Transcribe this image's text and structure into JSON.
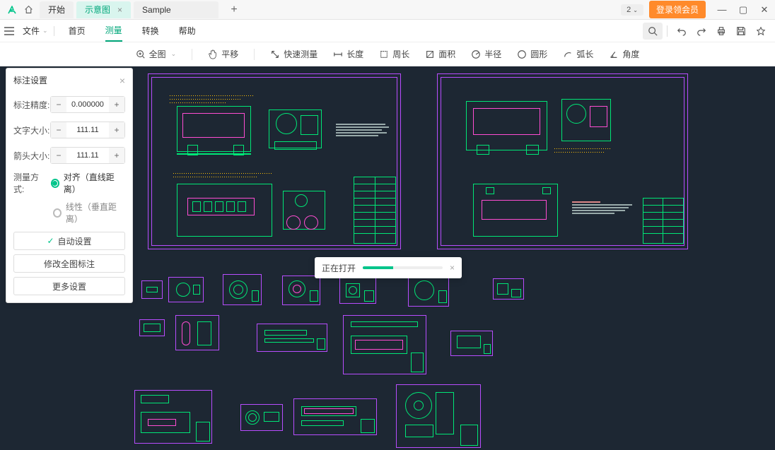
{
  "titlebar": {
    "tabs": [
      {
        "label": "开始",
        "active": false,
        "closable": false
      },
      {
        "label": "示意图",
        "active": true,
        "closable": true
      },
      {
        "label": "Sample",
        "active": false,
        "closable": false
      }
    ],
    "version_badge": "2",
    "login_btn": "登录领会员"
  },
  "menubar": {
    "file_label": "文件",
    "items": [
      {
        "label": "首页",
        "active": false
      },
      {
        "label": "测量",
        "active": true
      },
      {
        "label": "转换",
        "active": false
      },
      {
        "label": "帮助",
        "active": false
      }
    ]
  },
  "toolbar": {
    "items": [
      {
        "icon": "zoom-extents-icon",
        "label": "全图",
        "dropdown": true
      },
      {
        "icon": "pan-icon",
        "label": "平移"
      },
      {
        "icon": "quick-measure-icon",
        "label": "快速测量"
      },
      {
        "icon": "length-icon",
        "label": "长度"
      },
      {
        "icon": "perimeter-icon",
        "label": "周长"
      },
      {
        "icon": "area-icon",
        "label": "面积"
      },
      {
        "icon": "radius-icon",
        "label": "半径"
      },
      {
        "icon": "circle-icon",
        "label": "圆形"
      },
      {
        "icon": "arc-length-icon",
        "label": "弧长"
      },
      {
        "icon": "angle-icon",
        "label": "角度"
      }
    ]
  },
  "panel": {
    "title": "标注设置",
    "precision_label": "标注精度:",
    "precision_value": "0.000000",
    "textsize_label": "文字大小:",
    "textsize_value": "111.11",
    "arrowsize_label": "箭头大小:",
    "arrowsize_value": "111.11",
    "method_label": "测量方式:",
    "method_options": [
      {
        "label": "对齐（直线距离）",
        "selected": true
      },
      {
        "label": "线性（垂直距离）",
        "selected": false
      }
    ],
    "auto_btn": "自动设置",
    "modify_btn": "修改全图标注",
    "more_btn": "更多设置"
  },
  "toast": {
    "label": "正在打开"
  },
  "colors": {
    "accent": "#00c48a",
    "frame": "#b84dff",
    "draw_green": "#00e676",
    "draw_magenta": "#ff4dd2",
    "canvas_bg": "#1d2733",
    "login_orange": "#ff8a2b"
  }
}
